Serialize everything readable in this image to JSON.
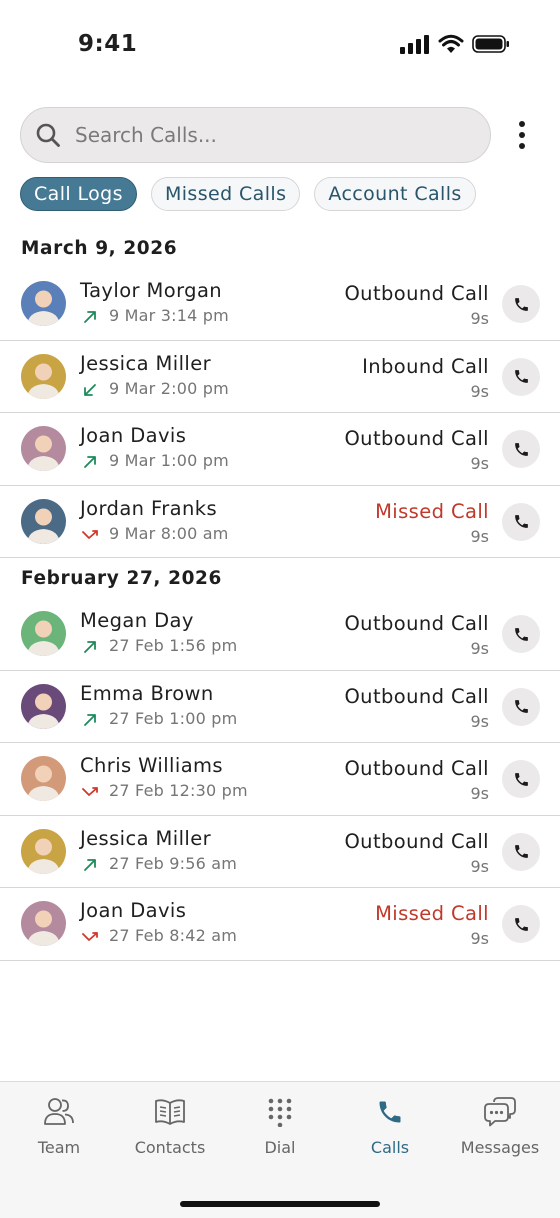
{
  "status_bar": {
    "time": "9:41"
  },
  "search": {
    "placeholder": "Search Calls...",
    "value": ""
  },
  "filters": [
    {
      "label": "Call Logs",
      "active": true
    },
    {
      "label": "Missed Calls",
      "active": false
    },
    {
      "label": "Account Calls",
      "active": false
    }
  ],
  "groups": [
    {
      "date": "March 9, 2026",
      "calls": [
        {
          "name": "Taylor Morgan",
          "time": "9 Mar 3:14 pm",
          "type": "Outbound Call",
          "duration": "9s",
          "direction": "outbound",
          "avatar_color": "#5b7fb8"
        },
        {
          "name": "Jessica Miller",
          "time": "9 Mar 2:00 pm",
          "type": "Inbound Call",
          "duration": "9s",
          "direction": "inbound",
          "avatar_color": "#c9a445"
        },
        {
          "name": "Joan Davis",
          "time": "9 Mar 1:00 pm",
          "type": "Outbound Call",
          "duration": "9s",
          "direction": "outbound",
          "avatar_color": "#b48a9e"
        },
        {
          "name": "Jordan Franks",
          "time": "9 Mar 8:00 am",
          "type": "Missed Call",
          "duration": "9s",
          "direction": "missed",
          "avatar_color": "#4a6a85"
        }
      ]
    },
    {
      "date": "February 27, 2026",
      "calls": [
        {
          "name": "Megan Day",
          "time": "27 Feb 1:56 pm",
          "type": "Outbound Call",
          "duration": "9s",
          "direction": "outbound",
          "avatar_color": "#6bb57a"
        },
        {
          "name": "Emma Brown",
          "time": "27 Feb 1:00 pm",
          "type": "Outbound Call",
          "duration": "9s",
          "direction": "outbound",
          "avatar_color": "#6a4a78"
        },
        {
          "name": "Chris Williams",
          "time": "27 Feb 12:30 pm",
          "type": "Outbound Call",
          "duration": "9s",
          "direction": "missed",
          "avatar_color": "#d39a7a"
        },
        {
          "name": "Jessica Miller",
          "time": "27 Feb 9:56 am",
          "type": "Outbound Call",
          "duration": "9s",
          "direction": "outbound",
          "avatar_color": "#c9a445"
        },
        {
          "name": "Joan Davis",
          "time": "27 Feb 8:42 am",
          "type": "Missed Call",
          "duration": "9s",
          "direction": "missed",
          "avatar_color": "#b48a9e"
        }
      ]
    }
  ],
  "colors": {
    "accent": "#467a94",
    "missed": "#c0392b",
    "outbound_arrow": "#1e8a5a",
    "missed_arrow": "#d0392b"
  },
  "tabs": [
    {
      "label": "Team",
      "icon": "people-icon",
      "active": false
    },
    {
      "label": "Contacts",
      "icon": "book-icon",
      "active": false
    },
    {
      "label": "Dial",
      "icon": "dialpad-icon",
      "active": false
    },
    {
      "label": "Calls",
      "icon": "phone-icon",
      "active": true
    },
    {
      "label": "Messages",
      "icon": "chat-bubbles-icon",
      "active": false
    }
  ]
}
